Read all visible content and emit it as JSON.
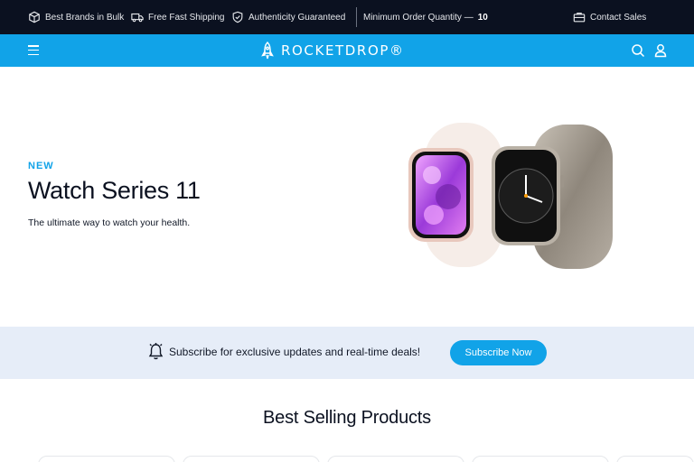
{
  "topbar": {
    "items": [
      {
        "icon": "box-icon",
        "label": "Best Brands in Bulk"
      },
      {
        "icon": "truck-icon",
        "label": "Free Fast Shipping"
      },
      {
        "icon": "shield-check-icon",
        "label": "Authenticity Guaranteed"
      }
    ],
    "min_order_label": "Minimum Order Quantity —",
    "min_order_value": "10",
    "contact_icon": "briefcase-icon",
    "contact_label": "Contact Sales"
  },
  "header": {
    "menu_icon": "hamburger-icon",
    "logo_text": "ROCKETDROP®",
    "search_icon": "search-icon",
    "account_icon": "user-icon",
    "background": "#11a3e8"
  },
  "hero": {
    "badge": "NEW",
    "title": "Watch Series 11",
    "subtitle": "The ultimate way to watch your health."
  },
  "subscribe": {
    "icon": "bell-icon",
    "text": "Subscribe for exclusive updates and real-time deals!",
    "button_label": "Subscribe Now",
    "background": "#e6edf8"
  },
  "best_selling": {
    "title": "Best Selling Products"
  },
  "colors": {
    "accent": "#11a3e8",
    "topbar": "#0b1120"
  }
}
